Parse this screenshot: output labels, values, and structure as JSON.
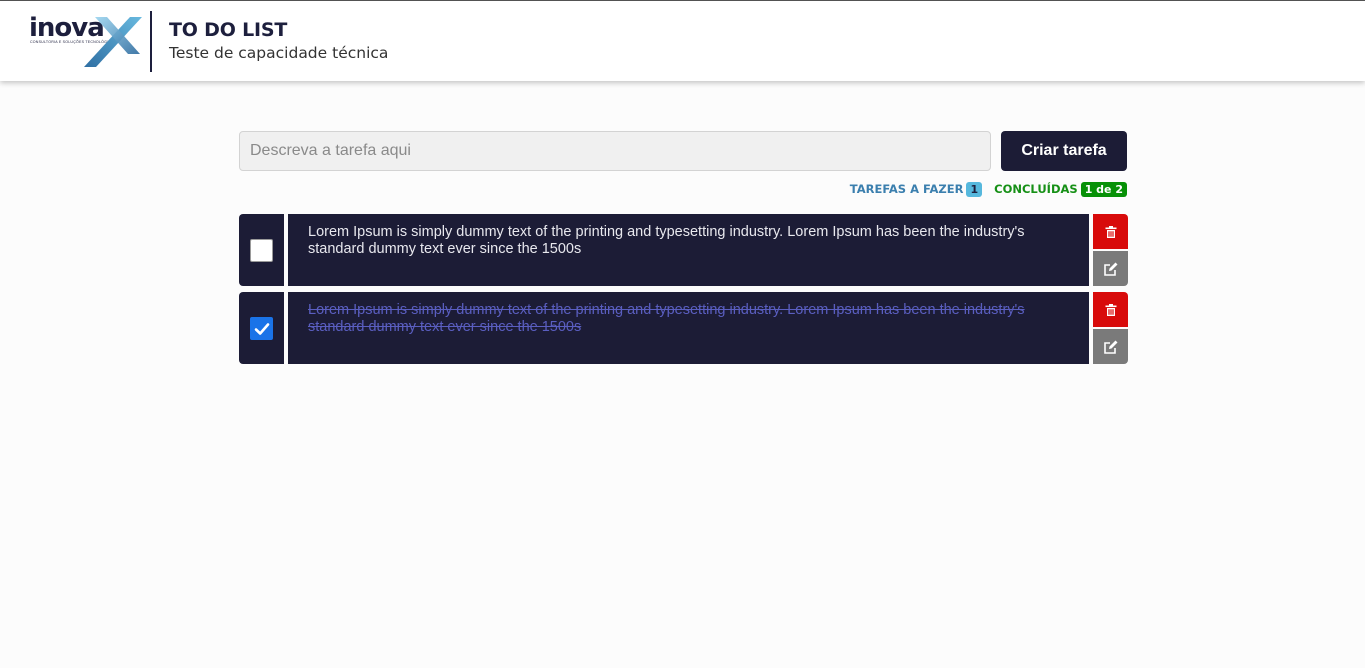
{
  "header": {
    "logo_text": "inova",
    "logo_tagline": "CONSULTORIA E SOLUÇÕES TECNOLÓGICAS",
    "title": "TO DO LIST",
    "subtitle": "Teste de capacidade técnica"
  },
  "form": {
    "input_placeholder": "Descreva a tarefa aqui",
    "input_value": "",
    "create_button": "Criar tarefa"
  },
  "counters": {
    "todo_label": "TAREFAS A FAZER",
    "todo_count": "1",
    "done_label": "CONCLUÍDAS",
    "done_count": "1 de 2"
  },
  "tasks": [
    {
      "text": "Lorem Ipsum is simply dummy text of the printing and typesetting industry. Lorem Ipsum has been the industry's standard dummy text ever since the 1500s",
      "completed": false
    },
    {
      "text": "Lorem Ipsum is simply dummy text of the printing and typesetting industry. Lorem Ipsum has been the industry's standard dummy text ever since the 1500s",
      "completed": true
    }
  ],
  "icons": {
    "delete": "trash-icon",
    "edit": "edit-icon"
  },
  "colors": {
    "primary": "#1c1c36",
    "delete": "#d80b0b",
    "edit": "#7a7a7a",
    "todo_badge": "#56b8dd",
    "done_badge": "#079107",
    "checkbox_checked": "#1a73e8"
  }
}
